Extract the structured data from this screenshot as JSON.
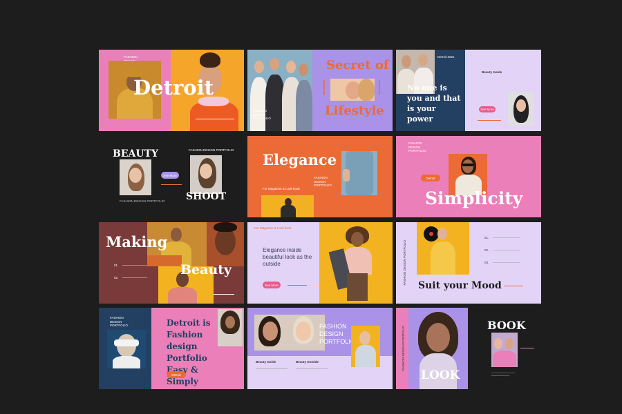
{
  "colors": {
    "background": "#1d1d1d",
    "pink": "#ea7fb9",
    "orange": "#ec6a35",
    "lavender": "#dcc9f5",
    "purple": "#a992e8",
    "navy": "#233f61",
    "maroon": "#7b3a3a",
    "dark": "#1d1d1d",
    "yellow": "#f3b321"
  },
  "slides": {
    "s1": {
      "label": "FASHION\nDESIGN\nPORTFOLIO",
      "title": "Detroit"
    },
    "s2": {
      "title_top": "Secret of",
      "title_bottom": "Lifestyle",
      "label": "FASHION\nDESIGN\nPORTFOLIO"
    },
    "s3": {
      "label": "Detroit 2021",
      "heading": "No one is you and that is your power",
      "side": "Beauty Inside",
      "button": "See More"
    },
    "s4": {
      "title_top": "BEAUTY",
      "title_bottom": "SHOOT",
      "label_top": "FASHION DESIGN PORTFOLIO",
      "button": "See More",
      "caption": "FASHION DESIGN PORTFOLIO"
    },
    "s5": {
      "title": "Elegance",
      "label": "FASHION\nDESIGN\nPORTFOLIO",
      "caption": "For Magazine & Look book"
    },
    "s6": {
      "label": "FASHION\nDESIGN\nPORTFOLIO",
      "button": "Detroit",
      "title": "Simplicity"
    },
    "s7": {
      "title_top": "Making",
      "title_bottom": "Beauty",
      "item1": "01.",
      "item2": "02."
    },
    "s8": {
      "caption": "For Magazine & Look book",
      "heading": "Elegance inside beautiful look as the outside",
      "button": "See More"
    },
    "s9": {
      "vertical": "FASHION DESIGN PORTFOLIO",
      "item1": "01.",
      "item2": "02.",
      "item3": "03.",
      "title": "Suit your Mood"
    },
    "s10": {
      "label": "FASHION\nDESIGN\nPORTFOLIO",
      "heading": "Detroit is Fashion design Portfolio Easy & Simply",
      "button": "Detroit"
    },
    "s11": {
      "heading": "FASHION\nDESIGN\nPORTFOLIO",
      "col1": "Beauty Inside",
      "col2": "Beauty Outside"
    },
    "s12": {
      "vertical": "FASHION DESIGN PORTFOLIO",
      "title_top": "BOOK",
      "title_bottom": "LOOK"
    }
  }
}
